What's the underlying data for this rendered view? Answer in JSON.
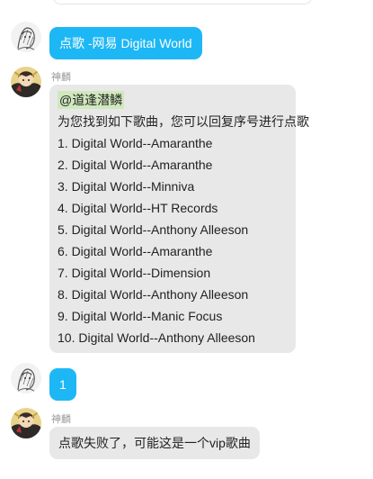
{
  "messages": {
    "user_request": {
      "text": "点歌 -网易 Digital World"
    },
    "bot_reply": {
      "sender": "神麟",
      "mention": "@道逢潜鳞",
      "intro": "为您找到如下歌曲，您可以回复序号进行点歌",
      "results": [
        "1. Digital World--Amaranthe",
        "2. Digital World--Amaranthe",
        "3. Digital World--Minniva",
        "4. Digital World--HT Records",
        "5. Digital World--Anthony Alleeson",
        "6. Digital World--Amaranthe",
        "7. Digital World--Dimension",
        "8. Digital World--Anthony Alleeson",
        "9. Digital World--Manic Focus",
        "10. Digital World--Anthony Alleeson"
      ]
    },
    "user_choice": {
      "text": "1"
    },
    "bot_fail": {
      "sender": "神麟",
      "text": "点歌失败了，可能这是一个vip歌曲"
    }
  },
  "colors": {
    "self_bubble": "#1eb7f5",
    "other_bubble": "#e8e8e8",
    "mention_highlight": "#cfe9bd",
    "sender_name": "#9a9a9a"
  },
  "icons": {
    "user_avatar": "sketch-portrait-avatar",
    "bot_avatar": "anime-character-avatar"
  }
}
